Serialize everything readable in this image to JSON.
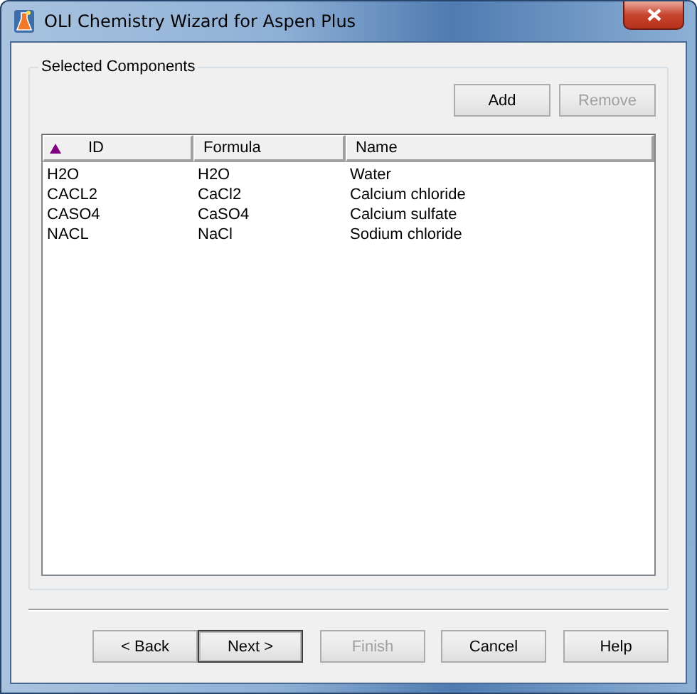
{
  "window": {
    "title": "OLI Chemistry Wizard for Aspen Plus"
  },
  "group": {
    "title": "Selected Components"
  },
  "list_buttons": [
    {
      "label": "Add",
      "disabled": false
    },
    {
      "label": "Remove",
      "disabled": true
    }
  ],
  "table": {
    "columns": [
      {
        "label": "ID",
        "sorted": true
      },
      {
        "label": "Formula",
        "sorted": false
      },
      {
        "label": "Name",
        "sorted": false
      }
    ],
    "rows": [
      [
        "H2O",
        "H2O",
        "Water"
      ],
      [
        "CACL2",
        "CaCl2",
        "Calcium chloride"
      ],
      [
        "CASO4",
        "CaSO4",
        "Calcium sulfate"
      ],
      [
        "NACL",
        "NaCl",
        "Sodium chloride"
      ]
    ]
  },
  "wizard_buttons": [
    {
      "label": "< Back",
      "disabled": false,
      "default": false
    },
    {
      "label": "Next >",
      "disabled": false,
      "default": true
    },
    {
      "label": "Finish",
      "disabled": true,
      "default": false
    },
    {
      "label": "Cancel",
      "disabled": false,
      "default": false
    },
    {
      "label": "Help",
      "disabled": false,
      "default": false
    }
  ]
}
